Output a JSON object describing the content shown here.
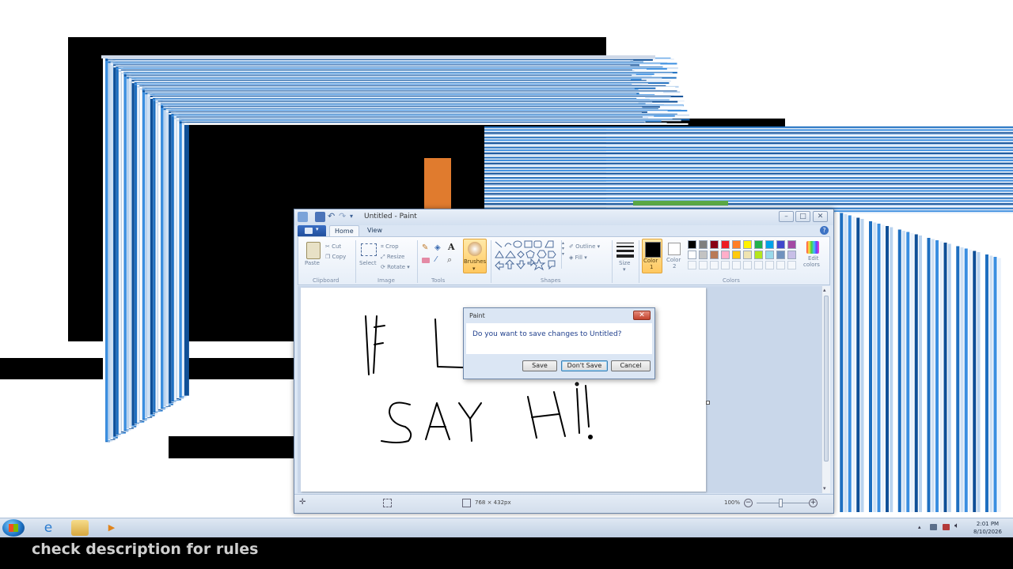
{
  "window": {
    "title": "Untitled - Paint",
    "tabs": [
      "Home",
      "View"
    ]
  },
  "ribbon": {
    "clipboard": {
      "label": "Clipboard",
      "paste": "Paste",
      "cut": "Cut",
      "copy": "Copy"
    },
    "image": {
      "label": "Image",
      "select": "Select",
      "crop": "Crop",
      "resize": "Resize",
      "rotate": "Rotate"
    },
    "tools": {
      "label": "Tools"
    },
    "brushes": {
      "label": "Brushes"
    },
    "shapes": {
      "label": "Shapes",
      "outline": "Outline",
      "fill": "Fill"
    },
    "size": {
      "label": "Size"
    },
    "color1": {
      "label": "Color",
      "index": "1"
    },
    "color2": {
      "label": "Color",
      "index": "2"
    },
    "colors": {
      "label": "Colors",
      "edit_label": "Edit",
      "edit_label2": "colors",
      "palette_row1": [
        "#000000",
        "#7f7f7f",
        "#880015",
        "#ed1c24",
        "#ff7f27",
        "#fff200",
        "#22b14c",
        "#00a2e8",
        "#3f48cc",
        "#a349a4"
      ],
      "palette_row2": [
        "#ffffff",
        "#c3c3c3",
        "#b97a57",
        "#ffaec9",
        "#ffc90e",
        "#efe4b0",
        "#b5e61d",
        "#99d9ea",
        "#7092be",
        "#c8bfe7"
      ]
    }
  },
  "canvas": {
    "drawing_line1": "IF U",
    "drawing_line2": "SAY Hi!"
  },
  "statusbar": {
    "dimensions": "768 × 432px",
    "zoom": "100%"
  },
  "dialog": {
    "title": "Paint",
    "message": "Do you want to save changes to Untitled?",
    "save": "Save",
    "dont_save": "Don't Save",
    "cancel": "Cancel"
  },
  "taskbar": {
    "time": "2:01 PM",
    "date": "8/10/2026"
  },
  "caption": "check description for rules"
}
